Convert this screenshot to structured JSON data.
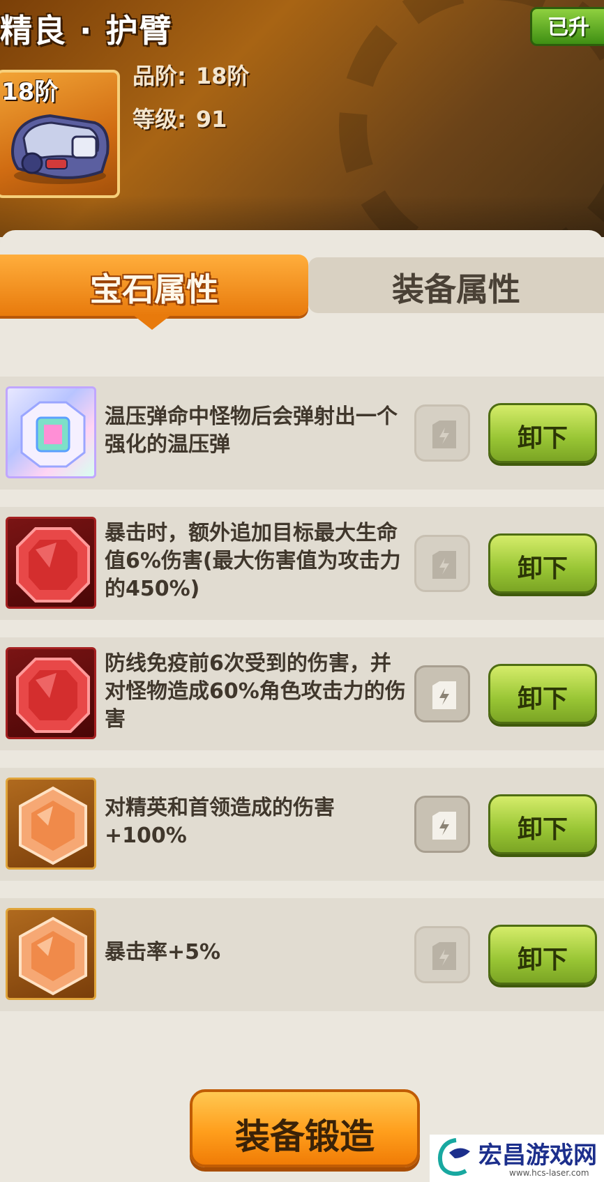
{
  "header": {
    "title": "精良 · 护臂",
    "upgraded_badge": "已升",
    "tier_label": "18阶",
    "stats": [
      {
        "label": "品阶:",
        "value": "18阶"
      },
      {
        "label": "等级:",
        "value": "91"
      }
    ]
  },
  "tabs": {
    "gem_attributes": "宝石属性",
    "equipment_attributes": "装备属性"
  },
  "gems": [
    {
      "type": "rainbow",
      "icon": "rainbow-gem-icon",
      "description": "温压弹命中怪物后会弹射出一个强化的温压弹",
      "lock": "dim",
      "unload_label": "卸下"
    },
    {
      "type": "red",
      "icon": "red-gem-icon",
      "description": "暴击时，额外追加目标最大生命值6%伤害(最大伤害值为攻击力的450%)",
      "lock": "dim",
      "unload_label": "卸下"
    },
    {
      "type": "red",
      "icon": "red-gem-icon",
      "description": "防线免疫前6次受到的伤害，并对怪物造成60%角色攻击力的伤害",
      "lock": "active",
      "unload_label": "卸下"
    },
    {
      "type": "orange",
      "icon": "orange-gem-icon",
      "description": "对精英和首领造成的伤害+100%",
      "lock": "active",
      "unload_label": "卸下"
    },
    {
      "type": "orange",
      "icon": "orange-gem-icon",
      "description": "暴击率+5%",
      "lock": "dim",
      "unload_label": "卸下"
    }
  ],
  "forge_button": "装备锻造",
  "watermark": {
    "name": "宏昌游戏网",
    "url": "www.hcs-laser.com"
  },
  "colors": {
    "tab_active": "#e87a0c",
    "unload_green": "#98c534",
    "forge_orange": "#ff9e1c"
  }
}
